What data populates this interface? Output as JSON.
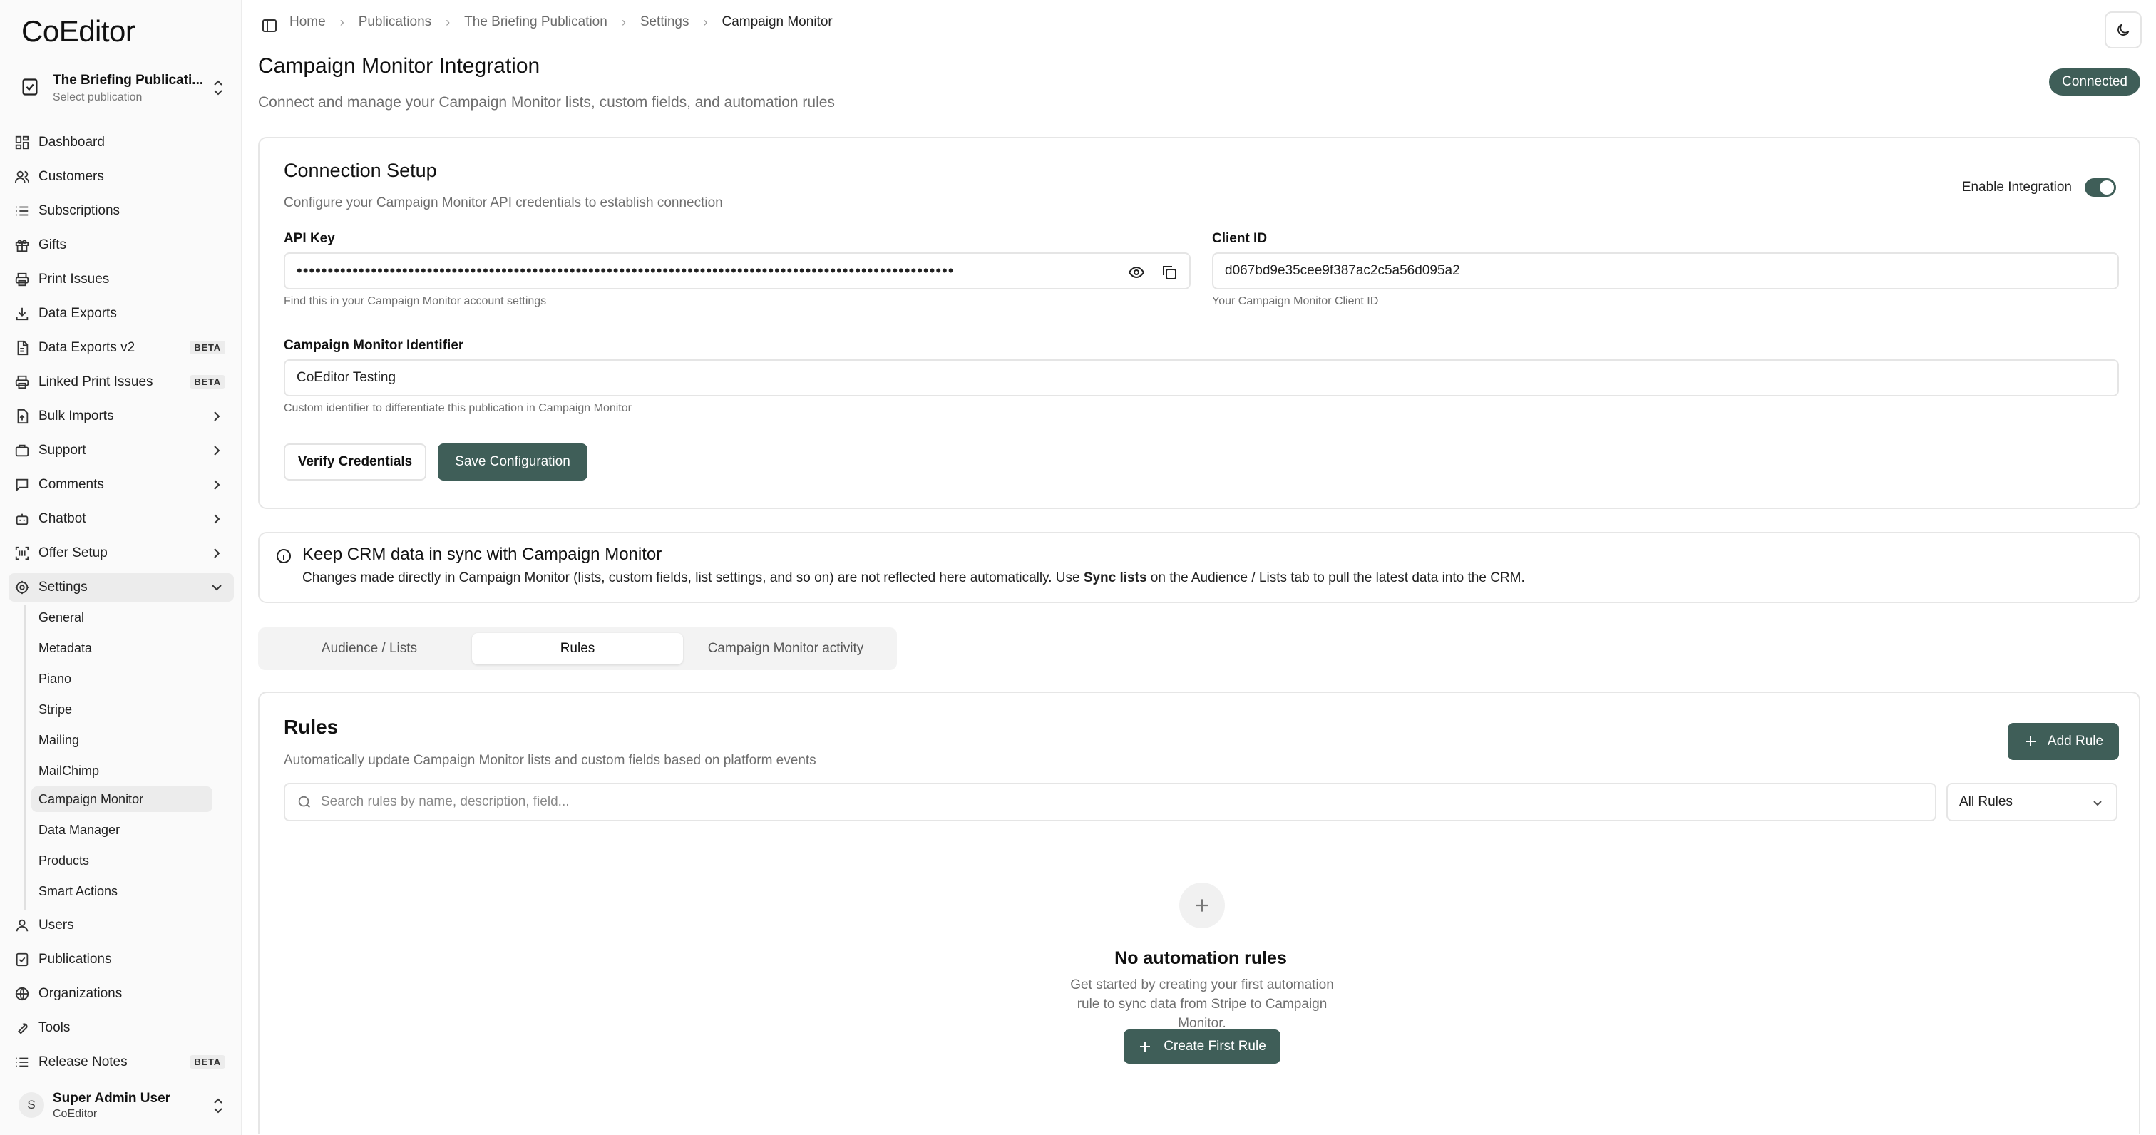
{
  "app": {
    "logo": "CoEditor"
  },
  "publication": {
    "name": "The Briefing Publicati...",
    "sub": "Select publication"
  },
  "nav": [
    {
      "label": "Dashboard"
    },
    {
      "label": "Customers"
    },
    {
      "label": "Subscriptions"
    },
    {
      "label": "Gifts"
    },
    {
      "label": "Print Issues"
    },
    {
      "label": "Data Exports"
    },
    {
      "label": "Data Exports v2",
      "badge": "BETA"
    },
    {
      "label": "Linked Print Issues",
      "badge": "BETA"
    },
    {
      "label": "Bulk Imports"
    },
    {
      "label": "Support"
    },
    {
      "label": "Comments"
    },
    {
      "label": "Chatbot"
    },
    {
      "label": "Offer Setup"
    },
    {
      "label": "Settings"
    }
  ],
  "settings_sub": [
    "General",
    "Metadata",
    "Piano",
    "Stripe",
    "Mailing",
    "MailChimp",
    "Campaign Monitor",
    "Data Manager",
    "Products",
    "Smart Actions"
  ],
  "nav_bottom": [
    {
      "label": "Users"
    },
    {
      "label": "Publications"
    },
    {
      "label": "Organizations"
    },
    {
      "label": "Tools"
    },
    {
      "label": "Release Notes",
      "badge": "BETA"
    }
  ],
  "user": {
    "initial": "S",
    "name": "Super Admin User",
    "org": "CoEditor"
  },
  "breadcrumb": [
    "Home",
    "Publications",
    "The Briefing Publication",
    "Settings",
    "Campaign Monitor"
  ],
  "page": {
    "title": "Campaign Monitor Integration",
    "description": "Connect and manage your Campaign Monitor lists, custom fields, and automation rules",
    "status": "Connected"
  },
  "connection": {
    "title": "Connection Setup",
    "subtitle": "Configure your Campaign Monitor API credentials to establish connection",
    "enable_label": "Enable Integration",
    "api_key_label": "API Key",
    "api_key_value": "••••••••••••••••••••••••••••••••••••••••••••••••••••••••••••••••••••••••••••••••••••••••••••••••••••••••••",
    "api_key_hint": "Find this in your Campaign Monitor account settings",
    "client_id_label": "Client ID",
    "client_id_value": "d067bd9e35cee9f387ac2c5a56d095a2",
    "client_id_hint": "Your Campaign Monitor Client ID",
    "identifier_label": "Campaign Monitor Identifier",
    "identifier_value": "CoEditor Testing",
    "identifier_hint": "Custom identifier to differentiate this publication in Campaign Monitor",
    "verify_label": "Verify Credentials",
    "save_label": "Save Configuration"
  },
  "info": {
    "title": "Keep CRM data in sync with Campaign Monitor",
    "body_pre": "Changes made directly in Campaign Monitor (lists, custom fields, list settings, and so on) are not reflected here automatically. Use ",
    "body_bold": "Sync lists",
    "body_post": " on the Audience / Lists tab to pull the latest data into the CRM."
  },
  "tabs": [
    "Audience / Lists",
    "Rules",
    "Campaign Monitor activity"
  ],
  "rules": {
    "title": "Rules",
    "subtitle": "Automatically update Campaign Monitor lists and custom fields based on platform events",
    "add_label": "Add Rule",
    "search_placeholder": "Search rules by name, description, field...",
    "filter_value": "All Rules",
    "empty_title": "No automation rules",
    "empty_desc": "Get started by creating your first automation rule to sync data from Stripe to Campaign Monitor.",
    "create_label": "Create First Rule"
  }
}
